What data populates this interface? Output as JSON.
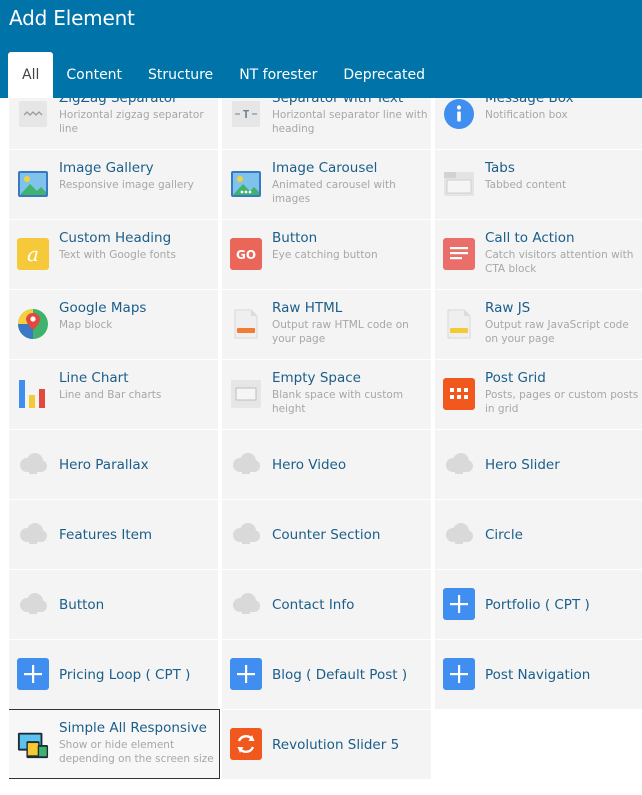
{
  "header": {
    "title": "Add Element",
    "tabs": [
      "All",
      "Content",
      "Structure",
      "NT forester",
      "Deprecated"
    ]
  },
  "elements": [
    {
      "title": "ZigZag Separator",
      "desc": "Horizontal zigzag separator line",
      "icon": "zigzag-icon"
    },
    {
      "title": "Separator with Text",
      "desc": "Horizontal separator line with heading",
      "icon": "separator-text-icon"
    },
    {
      "title": "Message Box",
      "desc": "Notification box",
      "icon": "info-icon"
    },
    {
      "title": "Image Gallery",
      "desc": "Responsive image gallery",
      "icon": "image-gallery-icon"
    },
    {
      "title": "Image Carousel",
      "desc": "Animated carousel with images",
      "icon": "image-carousel-icon"
    },
    {
      "title": "Tabs",
      "desc": "Tabbed content",
      "icon": "tabs-icon"
    },
    {
      "title": "Custom Heading",
      "desc": "Text with Google fonts",
      "icon": "custom-heading-icon"
    },
    {
      "title": "Button",
      "desc": "Eye catching button",
      "icon": "go-button-icon"
    },
    {
      "title": "Call to Action",
      "desc": "Catch visitors attention with CTA block",
      "icon": "call-to-action-icon"
    },
    {
      "title": "Google Maps",
      "desc": "Map block",
      "icon": "map-pin-icon"
    },
    {
      "title": "Raw HTML",
      "desc": "Output raw HTML code on your page",
      "icon": "raw-html-icon"
    },
    {
      "title": "Raw JS",
      "desc": "Output raw JavaScript code on your page",
      "icon": "raw-js-icon"
    },
    {
      "title": "Line Chart",
      "desc": "Line and Bar charts",
      "icon": "bar-chart-icon"
    },
    {
      "title": "Empty Space",
      "desc": "Blank space with custom height",
      "icon": "empty-space-icon"
    },
    {
      "title": "Post Grid",
      "desc": "Posts, pages or custom posts in grid",
      "icon": "post-grid-icon"
    },
    {
      "title": "Hero Parallax",
      "desc": "",
      "icon": "cloud-icon"
    },
    {
      "title": "Hero Video",
      "desc": "",
      "icon": "cloud-icon"
    },
    {
      "title": "Hero Slider",
      "desc": "",
      "icon": "cloud-icon"
    },
    {
      "title": "Features Item",
      "desc": "",
      "icon": "cloud-icon"
    },
    {
      "title": "Counter Section",
      "desc": "",
      "icon": "cloud-icon"
    },
    {
      "title": "Circle",
      "desc": "",
      "icon": "cloud-icon"
    },
    {
      "title": "Button",
      "desc": "",
      "icon": "cloud-icon"
    },
    {
      "title": "Contact Info",
      "desc": "",
      "icon": "cloud-icon"
    },
    {
      "title": "Portfolio ( CPT )",
      "desc": "",
      "icon": "plus-icon"
    },
    {
      "title": "Pricing Loop ( CPT )",
      "desc": "",
      "icon": "plus-icon"
    },
    {
      "title": "Blog ( Default Post )",
      "desc": "",
      "icon": "plus-icon"
    },
    {
      "title": "Post Navigation",
      "desc": "",
      "icon": "plus-icon"
    },
    {
      "title": "Simple All Responsive",
      "desc": "Show or hide element depending on the screen size",
      "icon": "responsive-devices-icon",
      "selected": true
    },
    {
      "title": "Revolution Slider 5",
      "desc": "",
      "icon": "refresh-icon"
    }
  ],
  "colors": {
    "header_bg": "#0074a8",
    "title_text": "#1b5e8a",
    "desc_text": "#a7a7a7",
    "cell_bg": "#f4f4f4",
    "blue_accent": "#3f8ef0"
  }
}
